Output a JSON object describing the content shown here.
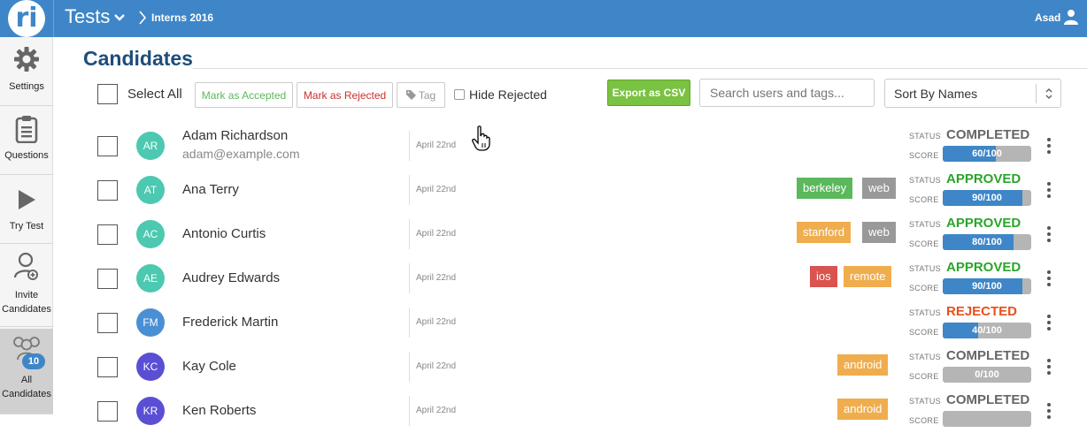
{
  "header": {
    "app_title": "Tests",
    "breadcrumb": "Interns 2016",
    "user_name": "Asad",
    "logo_text": "ri",
    "bg_color": "#3e86c8"
  },
  "sidebar": {
    "items": [
      {
        "label": "Settings",
        "icon": "gear-icon"
      },
      {
        "label": "Questions",
        "icon": "clipboard-icon"
      },
      {
        "label": "Try Test",
        "icon": "play-icon"
      },
      {
        "label": "Invite Candidates",
        "icon": "invite-user-icon"
      },
      {
        "label": "All Candidates",
        "icon": "users-group-icon",
        "badge": "10",
        "active": true
      }
    ]
  },
  "main": {
    "title": "Candidates",
    "toolbar": {
      "select_all": "Select All",
      "mark_accepted": "Mark as Accepted",
      "mark_rejected": "Mark as Rejected",
      "tag": "Tag",
      "hide_rejected": "Hide Rejected",
      "export_csv": "Export as CSV",
      "search_placeholder": "Search users and tags...",
      "sort_value": "Sort By Names"
    },
    "status_label": "STATUS",
    "score_label": "SCORE",
    "candidates": [
      {
        "initials": "AR",
        "avatar_color": "#4cc9b0",
        "name": "Adam Richardson",
        "email": "adam@example.com",
        "date": "April 22nd",
        "tags": [],
        "status": "COMPLETED",
        "score": "60/100",
        "score_fraction": 0.6
      },
      {
        "initials": "AT",
        "avatar_color": "#4cc9b0",
        "name": "Ana Terry",
        "email": "",
        "date": "April 22nd",
        "tags": [
          {
            "label": "berkeley",
            "color": "#5cb85c"
          },
          {
            "label": "web",
            "color": "#999999"
          }
        ],
        "status": "APPROVED",
        "score": "90/100",
        "score_fraction": 0.9
      },
      {
        "initials": "AC",
        "avatar_color": "#4cc9b0",
        "name": "Antonio Curtis",
        "email": "",
        "date": "April 22nd",
        "tags": [
          {
            "label": "stanford",
            "color": "#f0ad4e"
          },
          {
            "label": "web",
            "color": "#999999"
          }
        ],
        "status": "APPROVED",
        "score": "80/100",
        "score_fraction": 0.8
      },
      {
        "initials": "AE",
        "avatar_color": "#4cc9b0",
        "name": "Audrey Edwards",
        "email": "",
        "date": "April 22nd",
        "tags": [
          {
            "label": "ios",
            "color": "#d9534f"
          },
          {
            "label": "remote",
            "color": "#f0ad4e"
          }
        ],
        "status": "APPROVED",
        "score": "90/100",
        "score_fraction": 0.9
      },
      {
        "initials": "FM",
        "avatar_color": "#4a8fd4",
        "name": "Frederick Martin",
        "email": "",
        "date": "April 22nd",
        "tags": [],
        "status": "REJECTED",
        "score": "40/100",
        "score_fraction": 0.4
      },
      {
        "initials": "KC",
        "avatar_color": "#5a4fd4",
        "name": "Kay Cole",
        "email": "",
        "date": "April 22nd",
        "tags": [
          {
            "label": "android",
            "color": "#f0ad4e"
          }
        ],
        "status": "COMPLETED",
        "score": "0/100",
        "score_fraction": 0.0
      },
      {
        "initials": "KR",
        "avatar_color": "#5a4fd4",
        "name": "Ken Roberts",
        "email": "",
        "date": "April 22nd",
        "tags": [
          {
            "label": "android",
            "color": "#f0ad4e"
          }
        ],
        "status": "COMPLETED",
        "score": "",
        "score_fraction": 0.0
      }
    ]
  },
  "colors": {
    "completed": "#666666",
    "approved": "#2aa52a",
    "rejected": "#e8501c",
    "accent": "#3e86c8"
  }
}
